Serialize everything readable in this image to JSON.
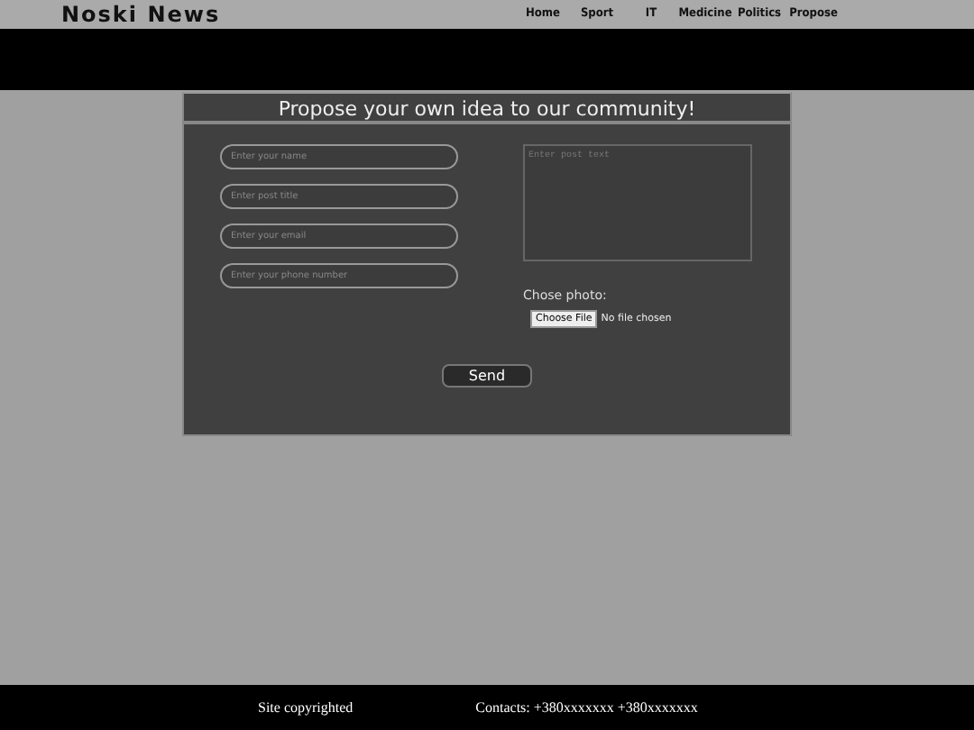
{
  "brand": "Noski News",
  "nav": [
    {
      "label": "Home"
    },
    {
      "label": "Sport"
    },
    {
      "label": "IT"
    },
    {
      "label": "Medicine"
    },
    {
      "label": "Politics"
    },
    {
      "label": "Propose"
    }
  ],
  "form": {
    "title": "Propose your own idea to our community!",
    "fields": [
      {
        "placeholder": "Enter your name"
      },
      {
        "placeholder": "Enter post title"
      },
      {
        "placeholder": "Enter your email"
      },
      {
        "placeholder": "Enter your phone number"
      }
    ],
    "post_text": {
      "placeholder": "Enter post text"
    },
    "photo": {
      "label": "Chose photo:",
      "button": "Choose File",
      "status": "No file chosen"
    },
    "submit": "Send"
  },
  "footer": {
    "copyright": "Site copyrighted",
    "contacts": "Contacts: +380xxxxxxx +380xxxxxxx"
  }
}
